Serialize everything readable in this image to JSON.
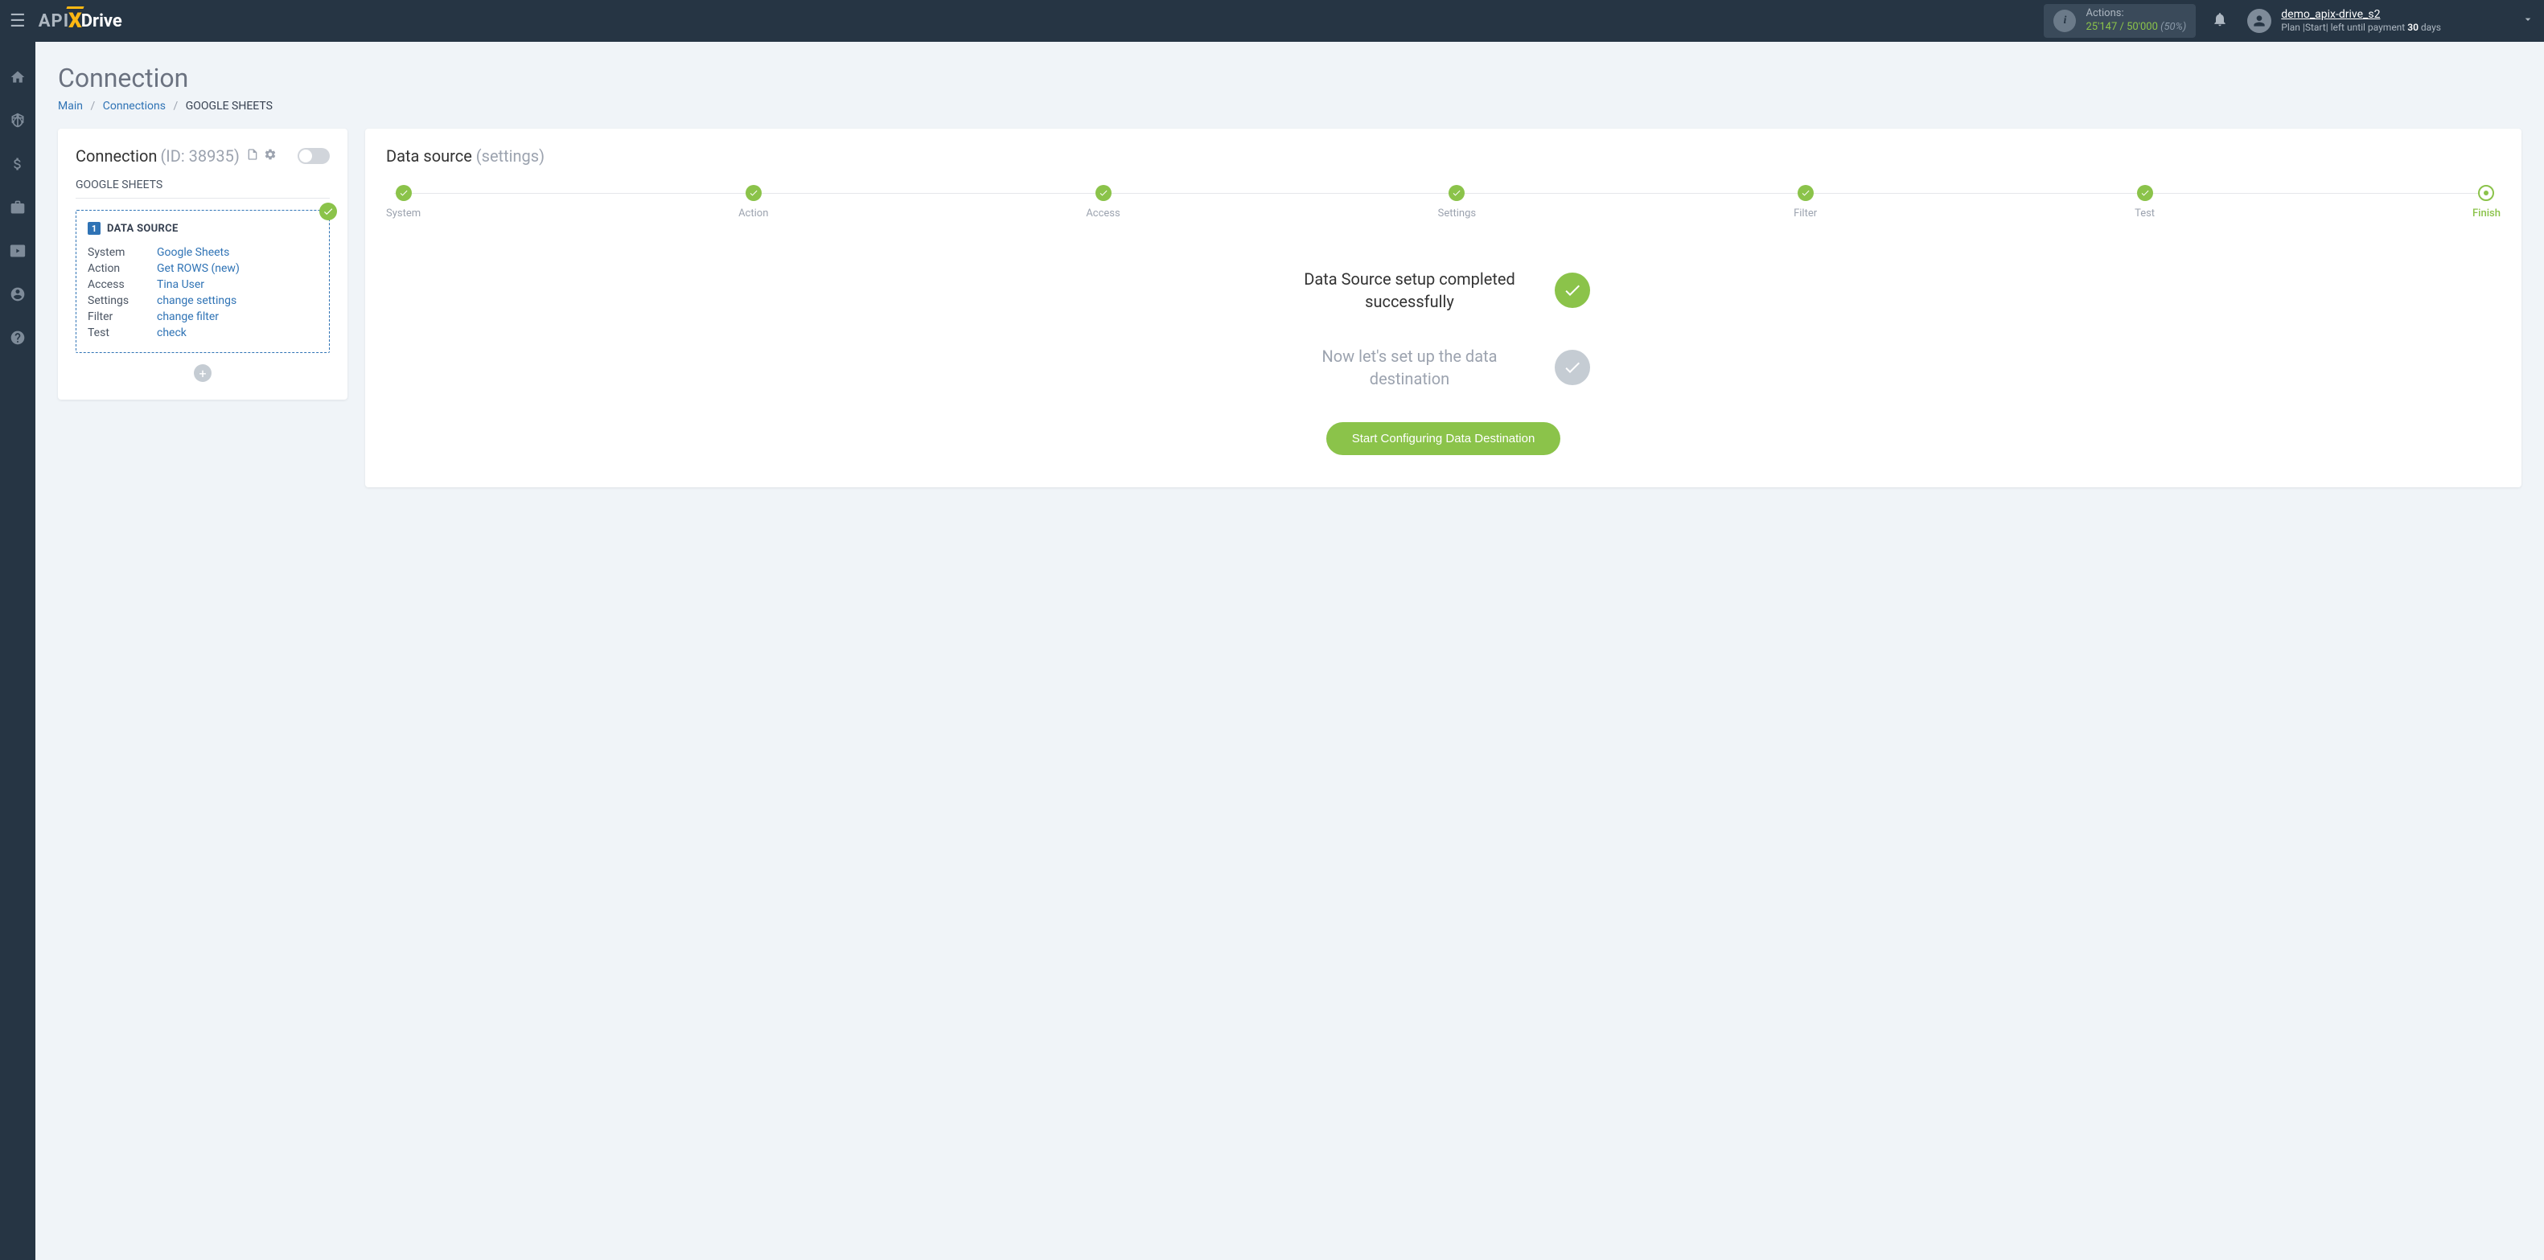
{
  "header": {
    "logo_api": "API",
    "logo_drive": "Drive",
    "actions_label": "Actions:",
    "actions_used": "25'147",
    "actions_sep": " / ",
    "actions_total": "50'000",
    "actions_pct": "(50%)",
    "username": "demo_apix-drive_s2",
    "plan_prefix": "Plan |Start| left until payment ",
    "plan_days": "30",
    "plan_suffix": " days"
  },
  "page": {
    "title": "Connection"
  },
  "breadcrumb": {
    "main": "Main",
    "connections": "Connections",
    "current": "GOOGLE SHEETS"
  },
  "left": {
    "title": "Connection",
    "id_label": "(ID: 38935)",
    "subtitle": "GOOGLE SHEETS",
    "ds_num": "1",
    "ds_title": "DATA SOURCE",
    "rows": [
      {
        "label": "System",
        "value": "Google Sheets"
      },
      {
        "label": "Action",
        "value": "Get ROWS (new)"
      },
      {
        "label": "Access",
        "value": "Tina User"
      },
      {
        "label": "Settings",
        "value": "change settings"
      },
      {
        "label": "Filter",
        "value": "change filter"
      },
      {
        "label": "Test",
        "value": "check"
      }
    ]
  },
  "right": {
    "title_dark": "Data source",
    "title_light": "(settings)",
    "steps": [
      {
        "label": "System",
        "done": true
      },
      {
        "label": "Action",
        "done": true
      },
      {
        "label": "Access",
        "done": true
      },
      {
        "label": "Settings",
        "done": true
      },
      {
        "label": "Filter",
        "done": true
      },
      {
        "label": "Test",
        "done": true
      },
      {
        "label": "Finish",
        "current": true
      }
    ],
    "success_msg": "Data Source setup completed successfully",
    "next_msg": "Now let's set up the data destination",
    "cta": "Start Configuring Data Destination"
  }
}
